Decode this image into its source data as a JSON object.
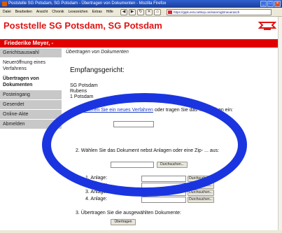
{
  "browser": {
    "title": "Poststelle SG Potsdam, SG Potsdam - Übertragen von Dokumenten - Mozilla Firefox",
    "menu": [
      "Datei",
      "Bearbeiten",
      "Ansicht",
      "Chronik",
      "Lesezeichen",
      "Extras",
      "Hilfe"
    ],
    "url": "https://gipk.esrv.netkop.on/eiarvmgb/neuerasch"
  },
  "page": {
    "title": "Poststelle SG Potsdam, SG Potsdam",
    "user": "Friederike Meyer, -"
  },
  "sidebar": {
    "items": [
      {
        "label": "Gerichtsauswahl"
      },
      {
        "label": "Neueröffnung eines Verfahrens"
      },
      {
        "label": "Übertragen von Dokumenten"
      },
      {
        "label": "Posteingang"
      },
      {
        "label": "Gesendet"
      },
      {
        "label": "Online-Akte"
      },
      {
        "label": "Abmelden"
      }
    ]
  },
  "main": {
    "breadcrumb": "Übertragen von Dokumenten",
    "heading": "Empfangsgericht:",
    "address": [
      "SG Potsdam",
      "Rubens",
      "1 Potsdam"
    ],
    "step1_num": "1.",
    "step1_link": "Initiieren Sie ein neues Verfahren",
    "step1_rest": "oder tragen Sie das ... nzeichen ein:",
    "step2": "2. Wählen Sie das Dokument nebst Anlagen oder eine Zip- ... aus:",
    "browse_label": "Durchsuchen...",
    "attachments": [
      "1. Anlage:",
      "2. Anlage:",
      "3. Anlage:",
      "4. Anlage:"
    ],
    "step3": "3. Übertragen Sie die ausgewählten Dokumente:",
    "submit_label": "Übertragen"
  }
}
